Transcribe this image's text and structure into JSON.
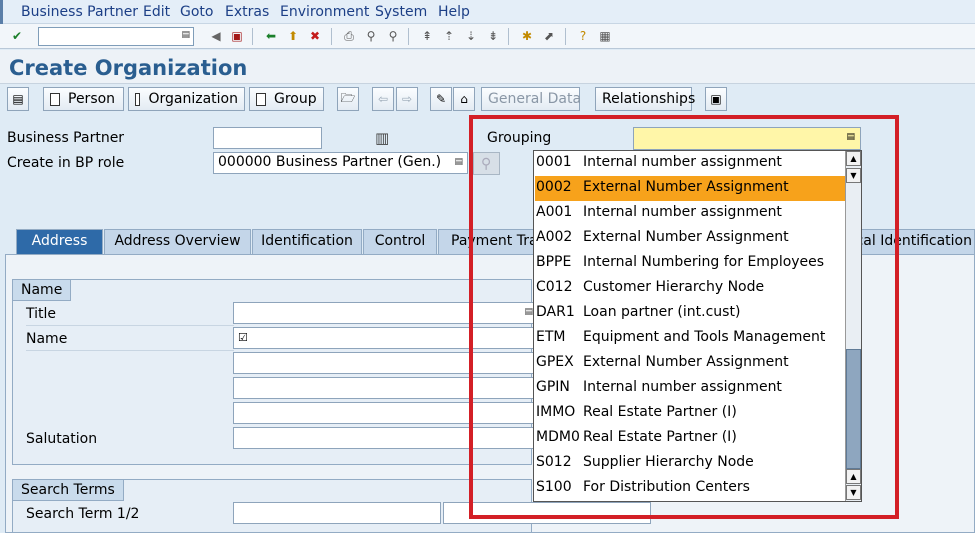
{
  "menubar": {
    "items": [
      "Business Partner",
      "Edit",
      "Goto",
      "Extras",
      "Environment",
      "System",
      "Help"
    ]
  },
  "page": {
    "title": "Create Organization"
  },
  "apptoolbar": {
    "person_label": "Person",
    "organization_label": "Organization",
    "group_label": "Group",
    "general_data_label": "General Data",
    "relationships_label": "Relationships"
  },
  "header": {
    "business_partner_label": "Business Partner",
    "business_partner_value": "",
    "role_label": "Create in BP role",
    "role_value": "000000 Business Partner (Gen.)",
    "grouping_label": "Grouping",
    "grouping_value": ""
  },
  "tabs": [
    {
      "label": "Address",
      "active": true
    },
    {
      "label": "Address Overview"
    },
    {
      "label": "Identification"
    },
    {
      "label": "Control"
    },
    {
      "label": "Payment Tra"
    },
    {
      "label": "nical Identification"
    }
  ],
  "name_group": {
    "title": "Name",
    "title_label": "Title",
    "name_label": "Name",
    "salutation_label": "Salutation"
  },
  "search_group": {
    "title": "Search Terms",
    "search_term_label": "Search Term 1/2"
  },
  "grouping_dropdown": {
    "selected_index": 1,
    "options": [
      {
        "code": "0001",
        "text": "Internal number assignment"
      },
      {
        "code": "0002",
        "text": "External Number Assignment"
      },
      {
        "code": "A001",
        "text": "Internal number assignment"
      },
      {
        "code": "A002",
        "text": "External Number Assignment"
      },
      {
        "code": "BPPE",
        "text": "Internal Numbering for Employees"
      },
      {
        "code": "C012",
        "text": "Customer Hierarchy Node"
      },
      {
        "code": "DAR1",
        "text": "Loan partner (int.cust)"
      },
      {
        "code": "ETM",
        "text": "Equipment and Tools Management"
      },
      {
        "code": "GPEX",
        "text": "External Number Assignment"
      },
      {
        "code": "GPIN",
        "text": "Internal number assignment"
      },
      {
        "code": "IMMO",
        "text": "Real Estate Partner (I)"
      },
      {
        "code": "MDM0",
        "text": "Real Estate Partner (I)"
      },
      {
        "code": "S012",
        "text": "Supplier Hierarchy Node"
      },
      {
        "code": "S100",
        "text": "For Distribution Centers"
      }
    ]
  },
  "colors": {
    "selected_option": "#f7a21b",
    "highlight_frame": "#d31f26",
    "title_text": "#2a5e90",
    "active_tab": "#2e6aa8"
  }
}
